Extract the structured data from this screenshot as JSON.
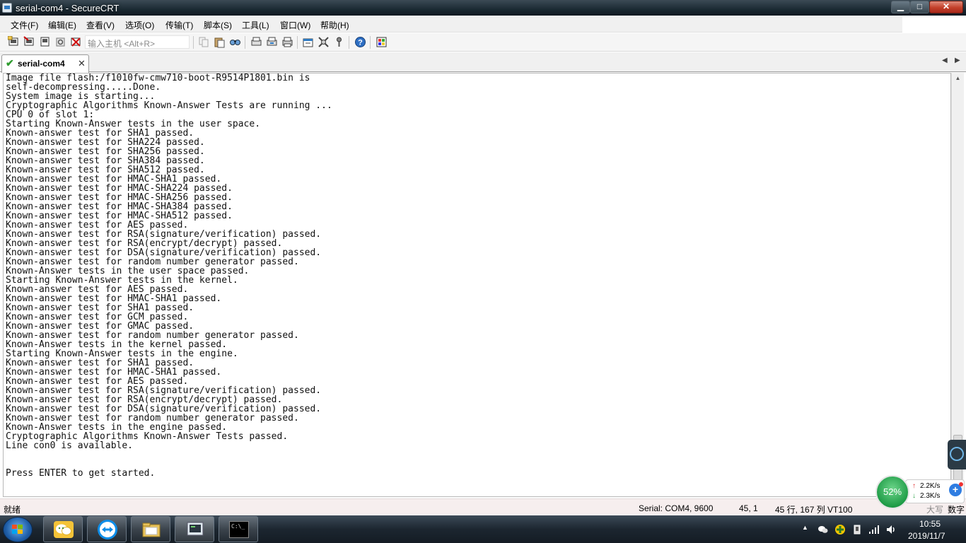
{
  "window": {
    "title": "serial-com4 - SecureCRT",
    "min_symbol": "▁",
    "max_symbol": "□",
    "close_symbol": "✕"
  },
  "menu": {
    "items": [
      "文件(F)",
      "编辑(E)",
      "查看(V)",
      "选项(O)",
      "传输(T)",
      "脚本(S)",
      "工具(L)",
      "窗口(W)",
      "帮助(H)"
    ]
  },
  "toolbar": {
    "quick_connect_placeholder": "输入主机 <Alt+R>",
    "icons": [
      "connect-icon",
      "quick-connect-icon",
      "connect-tab-icon",
      "reconnect-icon",
      "disconnect-icon",
      "copy-icon",
      "paste-icon",
      "find-icon",
      "print-setup-icon",
      "print-selection-icon",
      "print-icon",
      "session-options-icon",
      "global-options-icon",
      "keymap-icon",
      "help-icon",
      "screen-capture-icon"
    ]
  },
  "tabs": {
    "active": {
      "label": "serial-com4",
      "status_icon": "check-icon",
      "close_symbol": "✕"
    },
    "nav_left": "◀",
    "nav_right": "▶"
  },
  "terminal": {
    "lines": [
      "Image file flash:/f1010fw-cmw710-boot-R9514P1801.bin is",
      "self-decompressing.....Done.",
      "System image is starting...",
      "Cryptographic Algorithms Known-Answer Tests are running ...",
      "CPU 0 of slot 1:",
      "Starting Known-Answer tests in the user space.",
      "Known-answer test for SHA1 passed.",
      "Known-answer test for SHA224 passed.",
      "Known-answer test for SHA256 passed.",
      "Known-answer test for SHA384 passed.",
      "Known-answer test for SHA512 passed.",
      "Known-answer test for HMAC-SHA1 passed.",
      "Known-answer test for HMAC-SHA224 passed.",
      "Known-answer test for HMAC-SHA256 passed.",
      "Known-answer test for HMAC-SHA384 passed.",
      "Known-answer test for HMAC-SHA512 passed.",
      "Known-answer test for AES passed.",
      "Known-answer test for RSA(signature/verification) passed.",
      "Known-answer test for RSA(encrypt/decrypt) passed.",
      "Known-answer test for DSA(signature/verification) passed.",
      "Known-answer test for random number generator passed.",
      "Known-Answer tests in the user space passed.",
      "Starting Known-Answer tests in the kernel.",
      "Known-answer test for AES passed.",
      "Known-answer test for HMAC-SHA1 passed.",
      "Known-answer test for SHA1 passed.",
      "Known-answer test for GCM passed.",
      "Known-answer test for GMAC passed.",
      "Known-answer test for random number generator passed.",
      "Known-Answer tests in the kernel passed.",
      "Starting Known-Answer tests in the engine.",
      "Known-answer test for SHA1 passed.",
      "Known-answer test for HMAC-SHA1 passed.",
      "Known-answer test for AES passed.",
      "Known-answer test for RSA(signature/verification) passed.",
      "Known-answer test for RSA(encrypt/decrypt) passed.",
      "Known-answer test for DSA(signature/verification) passed.",
      "Known-answer test for random number generator passed.",
      "Known-Answer tests in the engine passed.",
      "Cryptographic Algorithms Known-Answer Tests passed.",
      "Line con0 is available.",
      "",
      "",
      "Press ENTER to get started."
    ]
  },
  "statusbar": {
    "ready": "就绪",
    "connection": "Serial: COM4, 9600",
    "cursor": "45,  1",
    "size": "45 行, 167 列 VT100",
    "caps": "大写",
    "num": "数字"
  },
  "net_monitor": {
    "percent": "52%",
    "upload": "2.2K/s",
    "download": "2.3K/s",
    "up_arrow": "↑",
    "down_arrow": "↓",
    "add_symbol": "+"
  },
  "taskbar": {
    "buttons": [
      "wechat-taskbar-button",
      "teamviewer-taskbar-button",
      "explorer-taskbar-button",
      "securecrt-taskbar-button",
      "cmd-taskbar-button"
    ],
    "cmd_label": "C:\\_",
    "clock": {
      "time": "10:55",
      "date": "2019/11/7"
    },
    "tray_expand": "▲"
  },
  "colors": {
    "start_flag_red": "#f25022",
    "start_flag_green": "#7fba00",
    "start_flag_blue": "#00a4ef",
    "start_flag_yellow": "#ffb900",
    "check_green": "#2e9b2e",
    "net_green": "#1f9c47"
  }
}
